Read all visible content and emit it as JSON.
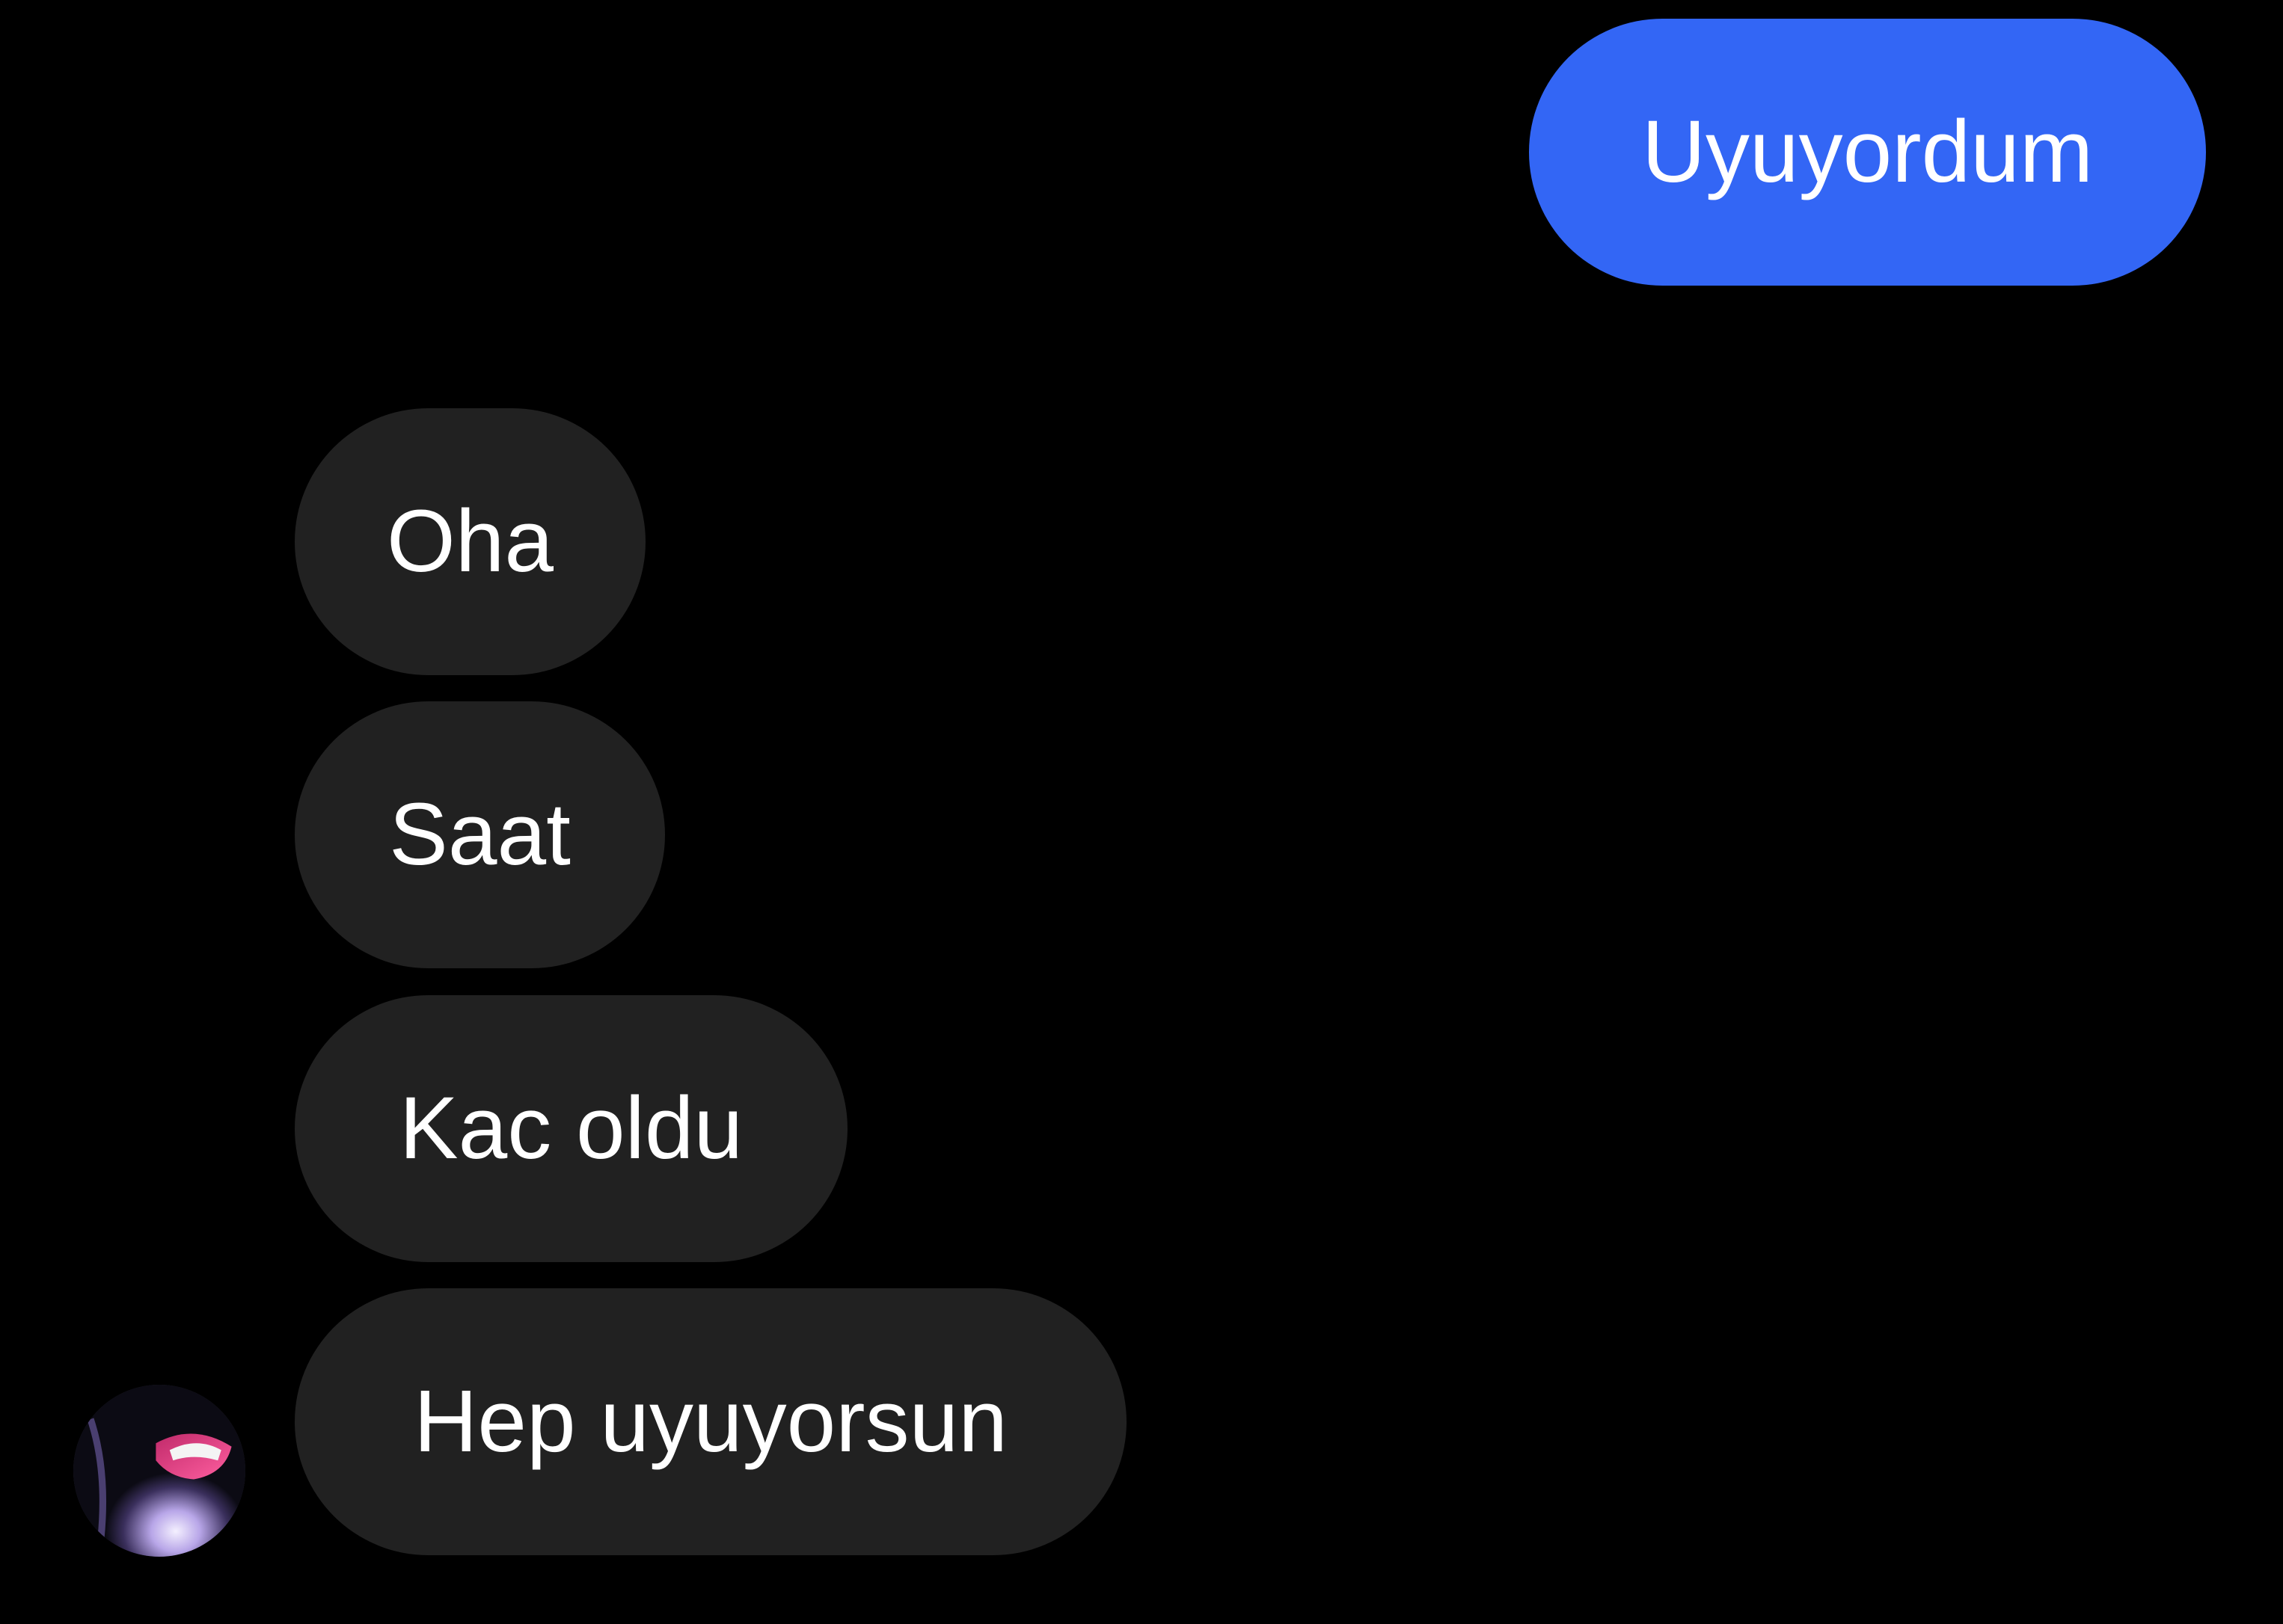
{
  "conversation": {
    "outgoing": [
      {
        "text": "Uyuyordum"
      }
    ],
    "incoming": [
      {
        "text": "Oha"
      },
      {
        "text": "Saat"
      },
      {
        "text": "Kac oldu"
      },
      {
        "text": "Hep uyuyorsun"
      }
    ],
    "contact_avatar_icon": "avatar-photo"
  },
  "colors": {
    "background": "#000000",
    "sent_bubble": "#3366f5",
    "received_bubble": "#212121",
    "text": "#ffffff"
  }
}
